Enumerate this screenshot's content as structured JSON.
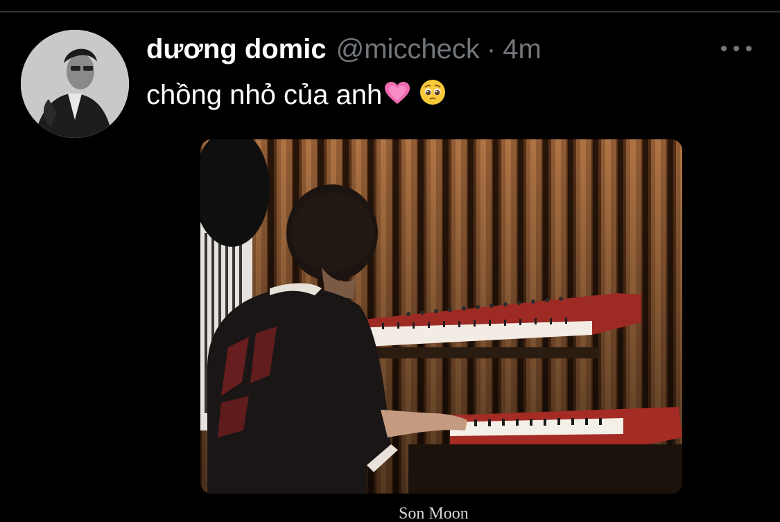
{
  "tweet": {
    "display_name": "dương domic",
    "handle": "@miccheck",
    "separator": "·",
    "time": "4m",
    "text": "chồng nhỏ của anh",
    "emojis": [
      "growing-heart-icon",
      "pleading-face-icon"
    ],
    "more_icon": "more-options-icon"
  },
  "media": {
    "watermark": "Son Moon"
  },
  "colors": {
    "background": "#000000",
    "divider": "#2f3336",
    "secondary_text": "#71767b",
    "primary_text": "#ffffff",
    "heart": "#f06ab0",
    "keyboard_red": "#b3302a"
  }
}
